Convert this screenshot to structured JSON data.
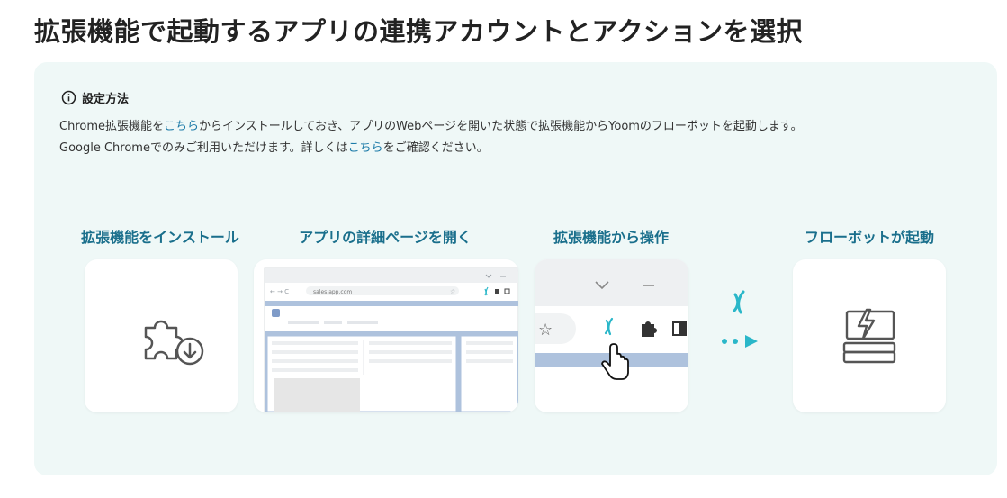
{
  "page_title": "拡張機能で起動するアプリの連携アカウントとアクションを選択",
  "info": {
    "heading": "設定方法",
    "line1_a": "Chrome拡張機能を",
    "line1_link": "こちら",
    "line1_b": "からインストールしておき、アプリのWebページを開いた状態で拡張機能からYoomのフローボットを起動します。",
    "line2_a": "Google Chromeでのみご利用いただけます。詳しくは",
    "line2_link": "こちら",
    "line2_b": "をご確認ください。"
  },
  "steps": [
    {
      "label": "拡張機能をインストール"
    },
    {
      "label": "アプリの詳細ページを開く"
    },
    {
      "label": "拡張機能から操作"
    },
    {
      "label": "フローボットが起動"
    }
  ],
  "browser_mock": {
    "url": "sales.app.com"
  },
  "colors": {
    "accent": "#1a6f8c",
    "link": "#1b7aa8",
    "yoom_teal": "#2ab7c9",
    "panel_bg": "#eff8f7"
  },
  "icons": [
    "info-icon",
    "puzzle-download-icon",
    "yoom-logo-icon",
    "puzzle-icon",
    "star-icon",
    "sidebar-icon",
    "hand-cursor-icon",
    "play-arrow-icon",
    "flowbot-icon"
  ]
}
